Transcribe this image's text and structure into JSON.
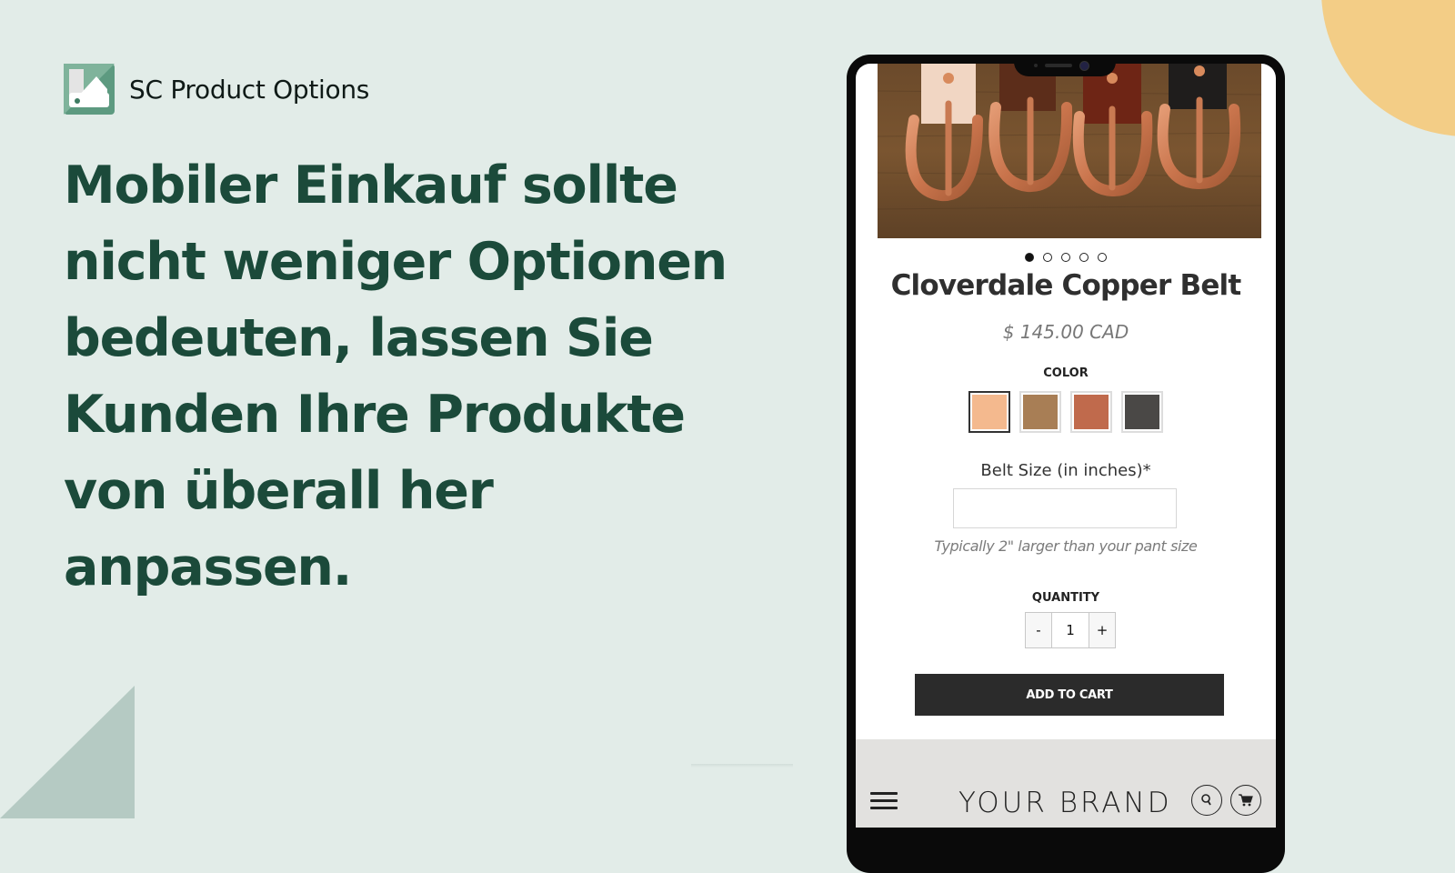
{
  "brand": {
    "app_name": "SC Product Options",
    "logo_icon": "swatch-logo-icon"
  },
  "headline": "Mobiler Einkauf sollte nicht weniger Optionen bedeuten, lassen Sie Kunden Ihre Produkte von überall her anpassen.",
  "colors": {
    "background": "#e2ece8",
    "headline": "#1b4a3a",
    "accent_circle": "#f3cd86",
    "accent_triangle": "#b5cac3",
    "button": "#2b2b2b"
  },
  "phone": {
    "carousel": {
      "image_alt": "Copper belt buckles on leather belts",
      "slide_count": 5,
      "active_slide": 1
    },
    "product": {
      "title": "Cloverdale Copper Belt",
      "price": "$ 145.00 CAD"
    },
    "color_option": {
      "label": "COLOR",
      "swatches": [
        {
          "name": "Natural",
          "color": "#f4b98e",
          "selected": true
        },
        {
          "name": "Tan",
          "color": "#a87e55",
          "selected": false
        },
        {
          "name": "Copper",
          "color": "#c06a4c",
          "selected": false
        },
        {
          "name": "Black",
          "color": "#4a4846",
          "selected": false
        }
      ]
    },
    "belt_size": {
      "label": "Belt Size (in inches)*",
      "value": "",
      "placeholder": "",
      "hint": "Typically 2\" larger than your pant size"
    },
    "quantity": {
      "label": "QUANTITY",
      "minus": "-",
      "value": "1",
      "plus": "+"
    },
    "add_to_cart": "ADD TO CART",
    "footer": {
      "menu_icon": "hamburger-icon",
      "brand": "YOUR BRAND",
      "search_icon": "search-icon",
      "cart_icon": "cart-icon"
    }
  }
}
